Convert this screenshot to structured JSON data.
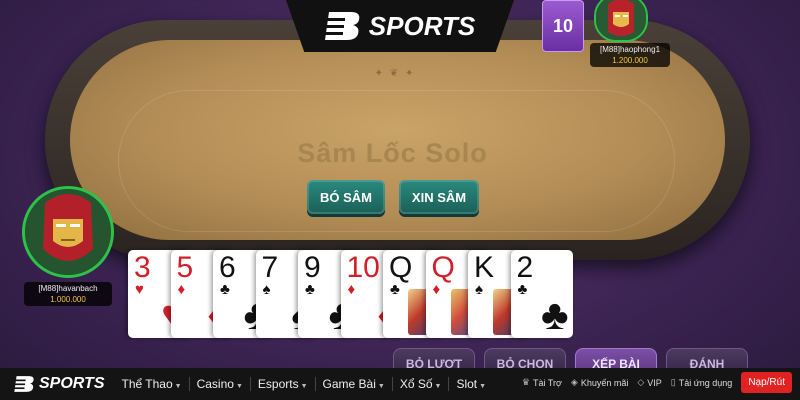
{
  "brand": {
    "logo_text": "SPORTS",
    "accent": "#e02222"
  },
  "table": {
    "title": "Sâm Lốc Solo"
  },
  "actions": {
    "bao_sam": "BÓ SÂM",
    "xin_sam": "XIN SÂM"
  },
  "players": {
    "left": {
      "name": "[M88]havanbach",
      "money": "1.000.000"
    },
    "right": {
      "name": "[M88]haophong1",
      "money": "1.200.000",
      "cards_left": "10"
    }
  },
  "hand": [
    {
      "rank": "3",
      "suit": "♥",
      "color": "red"
    },
    {
      "rank": "5",
      "suit": "♦",
      "color": "red"
    },
    {
      "rank": "6",
      "suit": "♣",
      "color": "black"
    },
    {
      "rank": "7",
      "suit": "♠",
      "color": "black"
    },
    {
      "rank": "9",
      "suit": "♣",
      "color": "black"
    },
    {
      "rank": "10",
      "suit": "♦",
      "color": "red"
    },
    {
      "rank": "Q",
      "suit": "♣",
      "color": "black"
    },
    {
      "rank": "Q",
      "suit": "♦",
      "color": "red"
    },
    {
      "rank": "K",
      "suit": "♠",
      "color": "black"
    },
    {
      "rank": "2",
      "suit": "♣",
      "color": "black"
    }
  ],
  "bottom_buttons": {
    "bo_luot": "BỎ LƯỢT",
    "bo_chon": "BỎ CHỌN",
    "xep_bai": "XẾP BÀI",
    "danh": "ĐÁNH"
  },
  "nav": {
    "logo_text": "SPORTS",
    "items": [
      "Thể Thao",
      "Casino",
      "Esports",
      "Game Bài",
      "Xổ Số",
      "Slot"
    ],
    "sponsor": "Tài Trợ",
    "promo": "Khuyến mãi",
    "vip": "VIP",
    "app": "Tải ứng dụng",
    "deposit": "Nạp/Rút"
  }
}
